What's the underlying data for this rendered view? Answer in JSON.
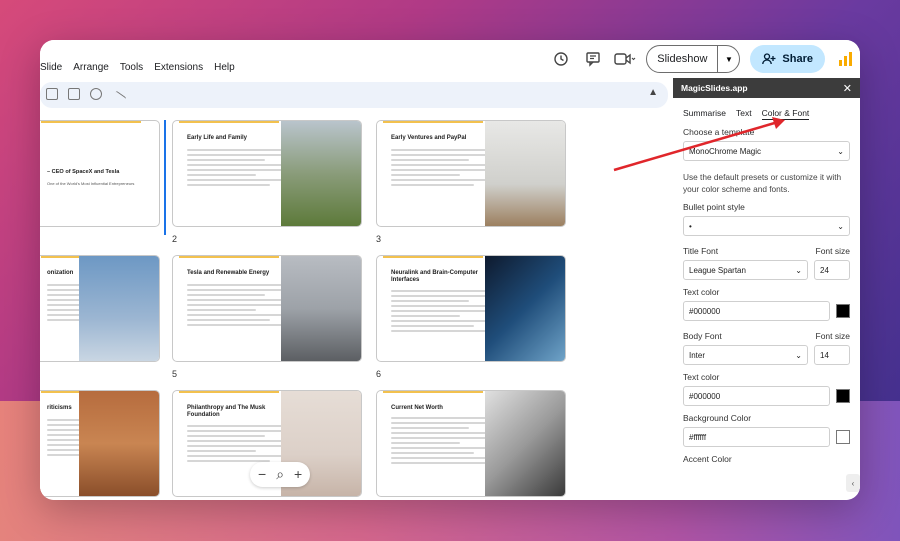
{
  "menu": [
    "Slide",
    "Arrange",
    "Tools",
    "Extensions",
    "Help"
  ],
  "top": {
    "slideshow_label": "Slideshow",
    "share_label": "Share"
  },
  "slides": [
    {
      "title": "– CEO of SpaceX and Tesla",
      "subtitle": "One of the World's Most Influential Entrepreneurs"
    },
    {
      "title": "Early Life and Family",
      "number": "2"
    },
    {
      "title": "Early Ventures and PayPal",
      "number": "3"
    },
    {
      "title": "onization"
    },
    {
      "title": "Tesla and Renewable Energy",
      "number": "5"
    },
    {
      "title": "Neuralink and Brain-Computer Interfaces",
      "number": "6"
    },
    {
      "title": "riticisms"
    },
    {
      "title": "Philanthropy and The Musk Foundation"
    },
    {
      "title": "Current Net Worth"
    }
  ],
  "sidebar": {
    "app_name": "MagicSlides.app",
    "close": "✕",
    "tabs": [
      "Summarise",
      "Text",
      "Color & Font"
    ],
    "choose_template_label": "Choose a template",
    "template_value": "MonoChrome Magic",
    "description": "Use the default presets or customize it with your color scheme and fonts.",
    "bullet_label": "Bullet point style",
    "bullet_value": "•",
    "title_font_label": "Title Font",
    "font_size_label": "Font size",
    "title_font_value": "League Spartan",
    "title_font_size": "24",
    "text_color_label": "Text color",
    "title_text_color": "#000000",
    "body_font_label": "Body Font",
    "body_font_value": "Inter",
    "body_font_size": "14",
    "body_text_color": "#000000",
    "bg_color_label": "Background Color",
    "bg_color_value": "#ffffff",
    "accent_color_label": "Accent Color"
  },
  "colors": {
    "accent_line": "#f2c14e",
    "arrow": "#e0262b",
    "share_bg": "#c2e7ff"
  }
}
